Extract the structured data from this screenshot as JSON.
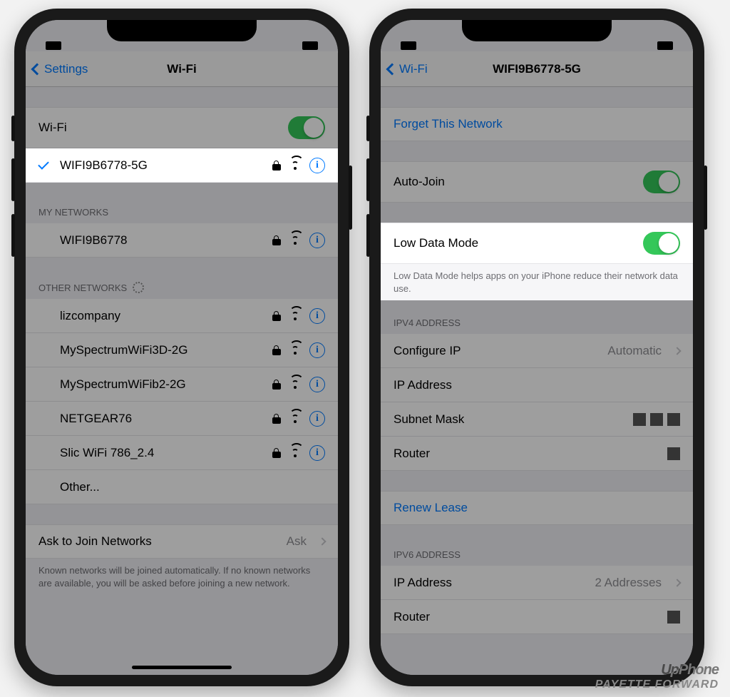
{
  "left": {
    "nav": {
      "back": "Settings",
      "title": "Wi-Fi"
    },
    "wifi_toggle_label": "Wi-Fi",
    "connected_network": "WIFI9B6778-5G",
    "my_networks_header": "MY NETWORKS",
    "my_networks": [
      "WIFI9B6778"
    ],
    "other_networks_header": "OTHER NETWORKS",
    "other_networks": [
      "lizcompany",
      "MySpectrumWiFi3D-2G",
      "MySpectrumWiFib2-2G",
      "NETGEAR76",
      "Slic WiFi 786_2.4"
    ],
    "other_label": "Other...",
    "ask_join_label": "Ask to Join Networks",
    "ask_join_value": "Ask",
    "ask_join_footer": "Known networks will be joined automatically. If no known networks are available, you will be asked before joining a new network."
  },
  "right": {
    "nav": {
      "back": "Wi-Fi",
      "title": "WIFI9B6778-5G"
    },
    "forget": "Forget This Network",
    "auto_join": "Auto-Join",
    "low_data_mode": "Low Data Mode",
    "low_data_footer": "Low Data Mode helps apps on your iPhone reduce their network data use.",
    "ipv4_header": "IPV4 ADDRESS",
    "configure_ip_label": "Configure IP",
    "configure_ip_value": "Automatic",
    "ip_address_label": "IP Address",
    "subnet_mask_label": "Subnet Mask",
    "router_label": "Router",
    "renew_lease": "Renew Lease",
    "ipv6_header": "IPV6 ADDRESS",
    "ipv6_ip_label": "IP Address",
    "ipv6_ip_value": "2 Addresses",
    "ipv6_router_label": "Router"
  },
  "watermark": {
    "line1": "UpPhone",
    "line2": "PAYETTE FORWARD"
  }
}
